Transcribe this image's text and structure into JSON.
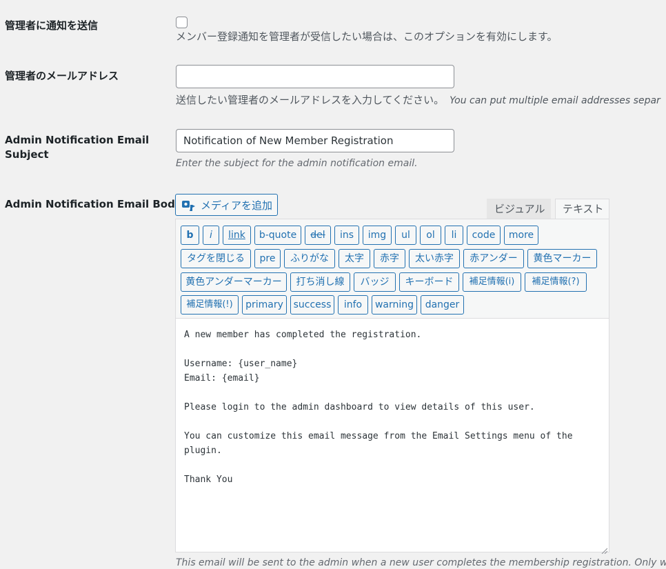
{
  "rows": {
    "notify_admin": {
      "label": "管理者に通知を送信",
      "checked": false,
      "description": "メンバー登録通知を管理者が受信したい場合は、このオプションを有効にします。"
    },
    "admin_email": {
      "label": "管理者のメールアドレス",
      "value": "",
      "description_jp": "送信したい管理者のメールアドレスを入力してください。",
      "description_en": "You can put multiple email addresses separ"
    },
    "email_subject": {
      "label": "Admin Notification Email Subject",
      "value": "Notification of New Member Registration",
      "description": "Enter the subject for the admin notification email."
    },
    "email_body": {
      "label": "Admin Notification Email Body",
      "add_media_label": "メディアを追加",
      "tab_visual": "ビジュアル",
      "tab_text": "テキスト",
      "toolbar": [
        "b",
        "i",
        "link",
        "b-quote",
        "del",
        "ins",
        "img",
        "ul",
        "ol",
        "li",
        "code",
        "more",
        "タグを閉じる",
        "pre",
        "ふりがな",
        "太字",
        "赤字",
        "太い赤字",
        "赤アンダー",
        "黄色マーカー",
        "黄色アンダーマーカー",
        "打ち消し線",
        "バッジ",
        "キーボード",
        "補足情報(i)",
        "補足情報(?)",
        "補足情報(!)",
        "primary",
        "success",
        "info",
        "warning",
        "danger"
      ],
      "content": "A new member has completed the registration.\n\nUsername: {user_name}\nEmail: {email}\n\nPlease login to the admin dashboard to view details of this user.\n\nYou can customize this email message from the Email Settings menu of the plugin.\n\nThank You",
      "description": "This email will be sent to the admin when a new user completes the membership registration. Only works"
    }
  },
  "colors": {
    "accent": "#2271b1",
    "page_bg": "#f1f1f1",
    "label_text": "#1d2327",
    "muted_text": "#50575e"
  }
}
